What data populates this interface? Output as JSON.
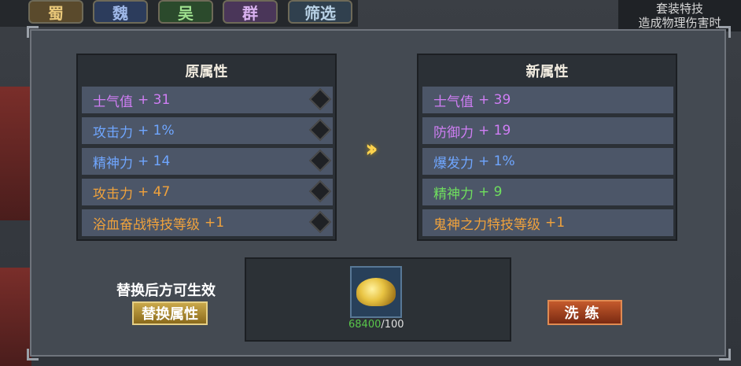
{
  "top_tabs": [
    "蜀",
    "魏",
    "吴",
    "群",
    "筛选"
  ],
  "right_info": {
    "line1": "套装特技",
    "line2": "造成物理伤害时"
  },
  "old_panel": {
    "title": "原属性",
    "rows": [
      {
        "name": "士气值",
        "value": "+ 31",
        "color": "purple"
      },
      {
        "name": "攻击力",
        "value": "+ 1%",
        "color": "blue"
      },
      {
        "name": "精神力",
        "value": "+ 14",
        "color": "blue"
      },
      {
        "name": "攻击力",
        "value": "+ 47",
        "color": "orange"
      },
      {
        "name": "浴血奋战特技等级",
        "value": "+1",
        "color": "orange"
      }
    ]
  },
  "new_panel": {
    "title": "新属性",
    "rows": [
      {
        "name": "士气值",
        "value": "+ 39",
        "color": "purple"
      },
      {
        "name": "防御力",
        "value": "+ 19",
        "color": "purple"
      },
      {
        "name": "爆发力",
        "value": "+ 1%",
        "color": "blue"
      },
      {
        "name": "精神力",
        "value": "+ 9",
        "color": "green"
      },
      {
        "name": "鬼神之力特技等级",
        "value": "+1",
        "color": "orange"
      }
    ]
  },
  "hint_text": "替换后方可生效",
  "replace_button": "替换属性",
  "refine_button": "洗练",
  "cost": {
    "have": "68400",
    "need": "/100",
    "icon": "gold-ore-icon"
  },
  "colors": {
    "purple": "#d07ef5",
    "blue": "#6fa6ff",
    "orange": "#f0a23c",
    "green": "#6fdf5e"
  }
}
